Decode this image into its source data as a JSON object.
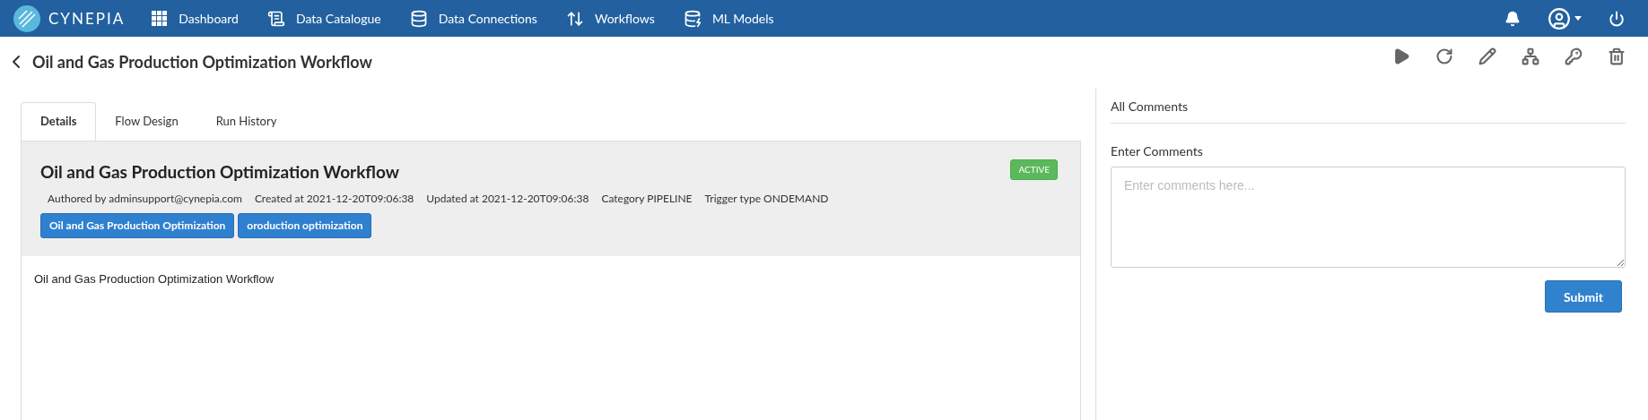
{
  "navbar": {
    "brand": "CYNEPIA",
    "items": [
      {
        "label": "Dashboard",
        "kind": "grid"
      },
      {
        "label": "Data Catalogue",
        "kind": "catalogue"
      },
      {
        "label": "Data Connections",
        "kind": "database"
      },
      {
        "label": "Workflows",
        "kind": "workflow"
      },
      {
        "label": "ML Models",
        "kind": "models"
      }
    ]
  },
  "page": {
    "title": "Oil and Gas Production Optimization Workflow"
  },
  "tabs": [
    {
      "label": "Details",
      "selected": true
    },
    {
      "label": "Flow Design",
      "selected": false
    },
    {
      "label": "Run History",
      "selected": false
    }
  ],
  "details": {
    "title": "Oil and Gas Production Optimization Workflow",
    "status": {
      "label": "ACTIVE",
      "kind": "active"
    },
    "meta": [
      "Authored by adminsupport@cynepia.com",
      "Created at 2021-12-20T09:06:38",
      "Updated at 2021-12-20T09:06:38",
      "Category PIPELINE",
      "Trigger type ONDEMAND"
    ],
    "tags": [
      "Oil and Gas Production Optimization",
      "oroduction optimization"
    ],
    "description": "Oil and Gas Production Optimization Workflow"
  },
  "comments": {
    "heading": "All Comments",
    "label": "Enter Comments",
    "placeholder": "Enter comments here...",
    "submit": "Submit"
  }
}
